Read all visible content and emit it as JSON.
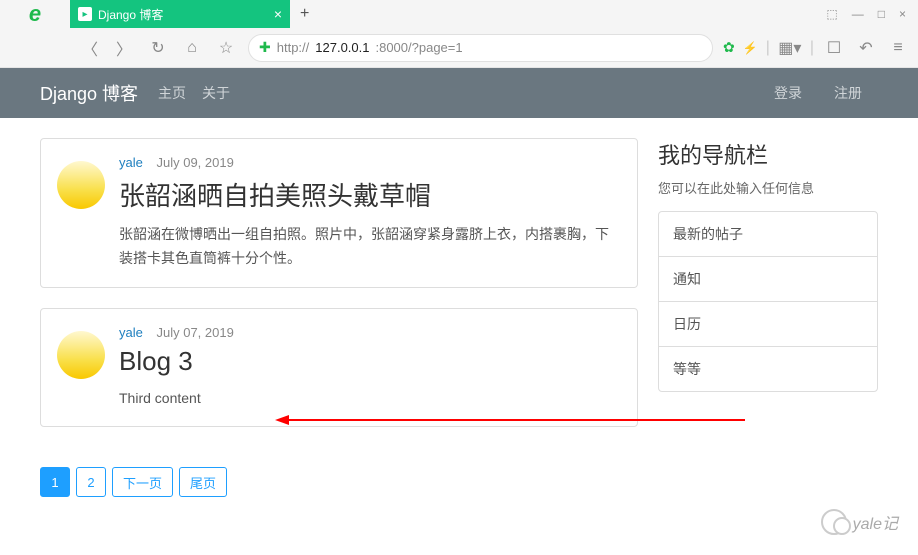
{
  "titlebar": {
    "tab_title": "Django 博客",
    "close": "×",
    "add": "+",
    "pin": "⬚",
    "min": "—",
    "max": "□",
    "exit": "×"
  },
  "toolbar": {
    "url_http": "http://",
    "url_host": "127.0.0.1",
    "url_path": ":8000/?page=1"
  },
  "nav": {
    "brand": "Django 博客",
    "home": "主页",
    "about": "关于",
    "login": "登录",
    "register": "注册"
  },
  "posts": [
    {
      "author": "yale",
      "date": "July 09, 2019",
      "title": "张韶涵晒自拍美照头戴草帽",
      "content": "张韶涵在微博晒出一组自拍照。照片中，张韶涵穿紧身露脐上衣，内搭裹胸，下装搭卡其色直筒裤十分个性。"
    },
    {
      "author": "yale",
      "date": "July 07, 2019",
      "title": "Blog 3",
      "content": "Third content"
    }
  ],
  "sidebar": {
    "title": "我的导航栏",
    "sub": "您可以在此处输入任何信息",
    "items": [
      "最新的帖子",
      "通知",
      "日历",
      "等等"
    ]
  },
  "pagination": {
    "p1": "1",
    "p2": "2",
    "next": "下一页",
    "last": "尾页"
  },
  "watermark": "yale记"
}
